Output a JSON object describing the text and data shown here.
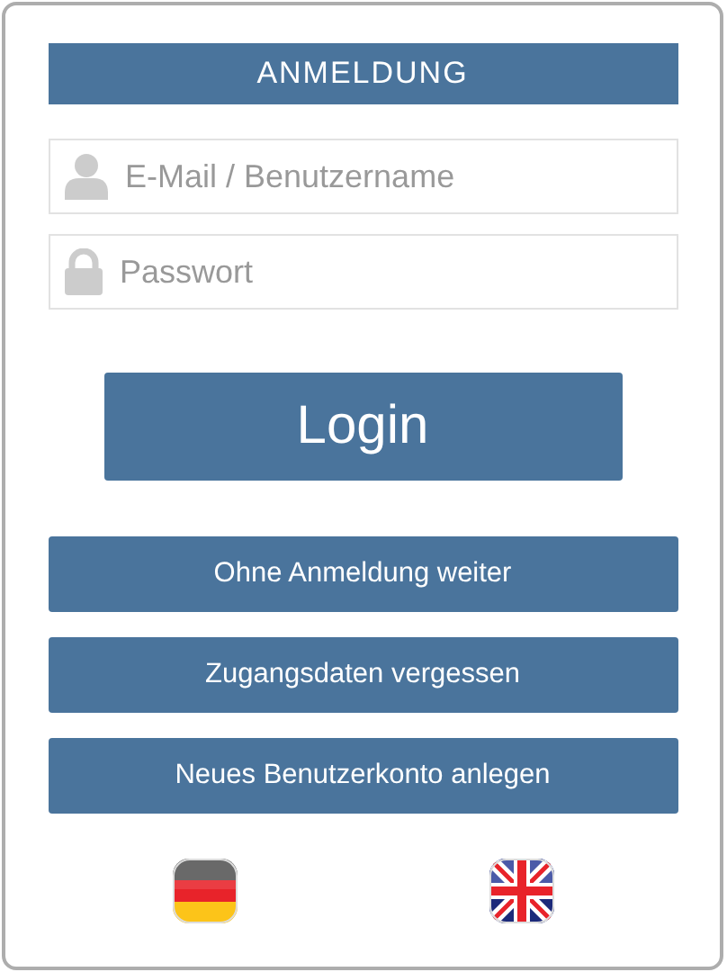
{
  "header": {
    "title": "ANMELDUNG"
  },
  "fields": [
    {
      "kind": "user",
      "placeholder": "E-Mail / Benutzername"
    },
    {
      "kind": "lock",
      "placeholder": "Passwort"
    }
  ],
  "login_button": "Login",
  "buttons": [
    "Ohne Anmeldung weiter",
    "Zugangsdaten vergessen",
    "Neues Benutzerkonto anlegen"
  ],
  "languages": [
    {
      "kind": "de"
    },
    {
      "kind": "en"
    }
  ]
}
